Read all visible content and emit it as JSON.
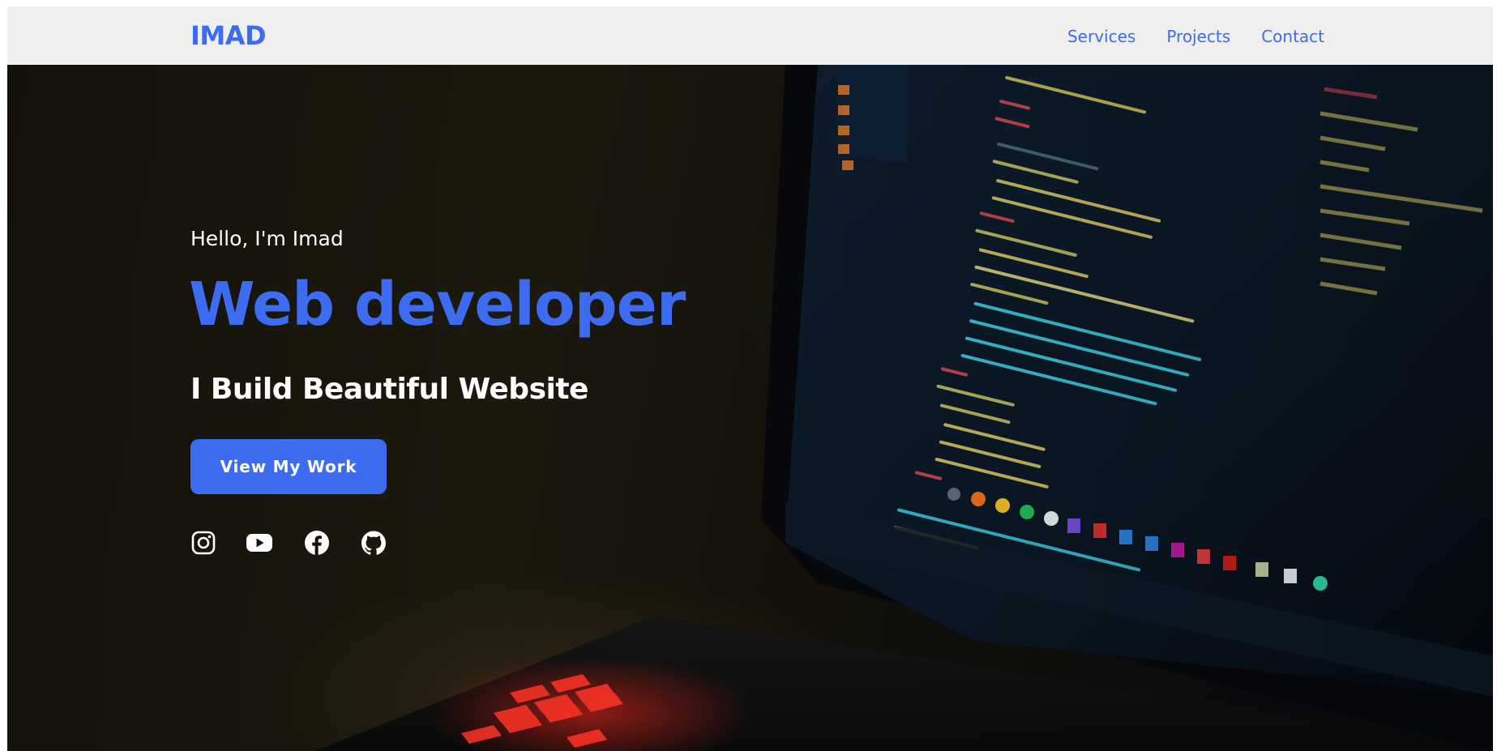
{
  "navbar": {
    "logo": "IMAD",
    "links": [
      {
        "label": "Services"
      },
      {
        "label": "Projects"
      },
      {
        "label": "Contact"
      }
    ]
  },
  "hero": {
    "greeting": "Hello, I'm Imad",
    "headline": "Web developer",
    "subheadline": "I Build Beautiful Website",
    "cta_label": "View My Work",
    "background_image": "laptop-code-photo",
    "socials": [
      {
        "icon": "instagram-icon"
      },
      {
        "icon": "youtube-icon"
      },
      {
        "icon": "facebook-icon"
      },
      {
        "icon": "github-icon"
      }
    ]
  },
  "colors": {
    "accent": "#3e6cf0",
    "navbar_bg": "#efefef",
    "hero_text": "#ffffff"
  }
}
